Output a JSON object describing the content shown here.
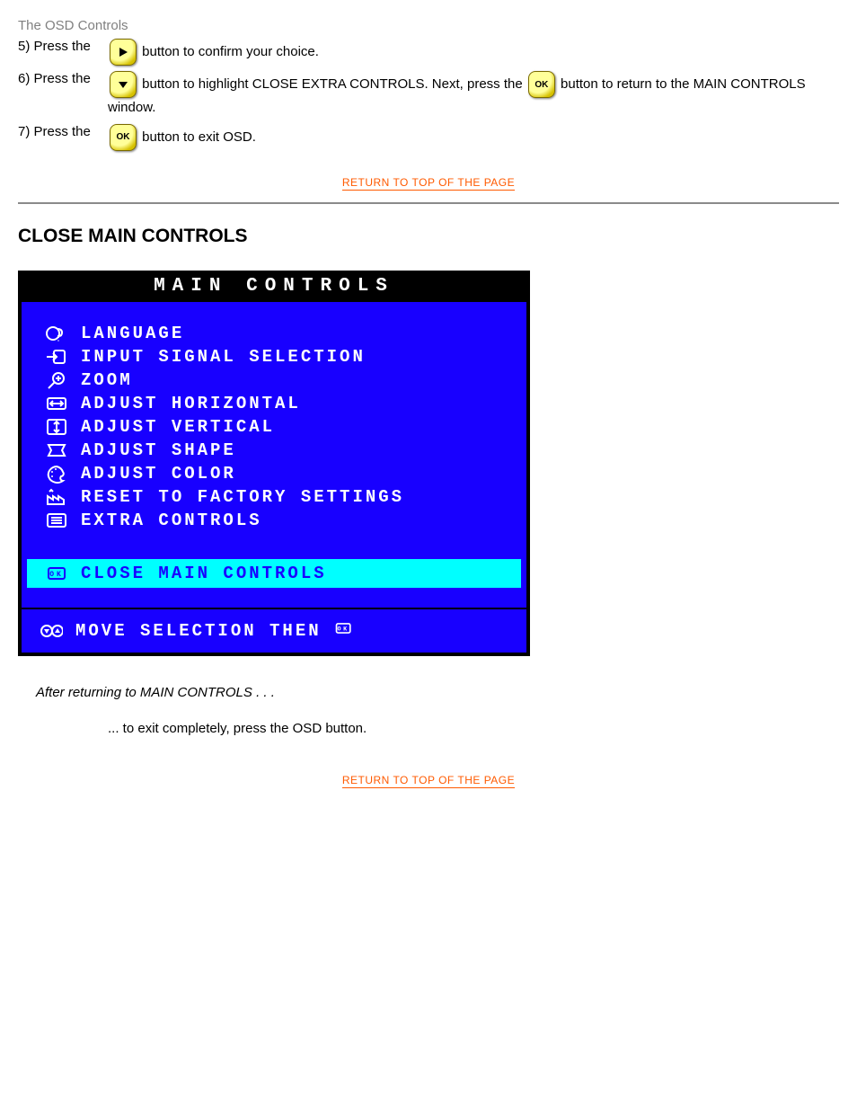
{
  "page_header": "The OSD Controls",
  "steps": [
    {
      "num": "5) Press the",
      "tail": "button to confirm your choice.",
      "iconType": "play"
    },
    {
      "num": "6) Press the",
      "tail": "button to highlight CLOSE EXTRA CONTROLS. Next, press the          button to return to the MAIN CONTROLS window.",
      "iconType": "down",
      "secondIcon": "ok"
    },
    {
      "num": "7) Press the",
      "tail": "button to exit OSD.",
      "iconType": "ok"
    }
  ],
  "topLink": "RETURN TO TOP OF THE PAGE",
  "section": "CLOSE MAIN CONTROLS",
  "osd": {
    "title": "MAIN CONTROLS",
    "items": [
      {
        "name": "lang",
        "label": "LANGUAGE"
      },
      {
        "name": "input",
        "label": "INPUT SIGNAL SELECTION"
      },
      {
        "name": "zoom",
        "label": "ZOOM"
      },
      {
        "name": "horiz",
        "label": "ADJUST HORIZONTAL"
      },
      {
        "name": "vert",
        "label": "ADJUST VERTICAL"
      },
      {
        "name": "shape",
        "label": "ADJUST SHAPE"
      },
      {
        "name": "color",
        "label": "ADJUST COLOR"
      },
      {
        "name": "reset",
        "label": "RESET TO FACTORY SETTINGS"
      },
      {
        "name": "extra",
        "label": "EXTRA CONTROLS"
      }
    ],
    "highlight": {
      "name": "close",
      "label": "CLOSE MAIN CONTROLS"
    },
    "footer": "MOVE SELECTION THEN"
  },
  "footnote": "After returning to MAIN CONTROLS . . .",
  "body": "... to exit completely, press the OSD button."
}
